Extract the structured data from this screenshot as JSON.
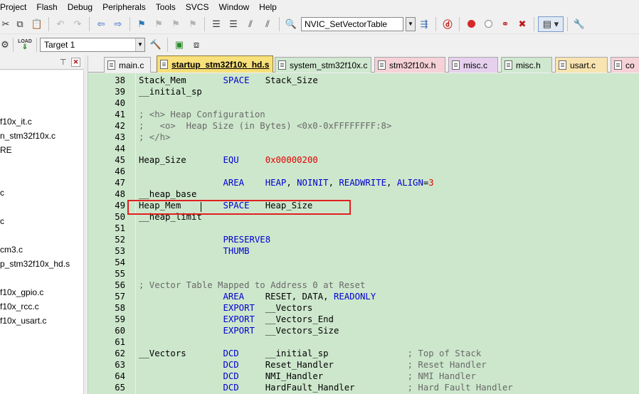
{
  "menu": [
    "Project",
    "Flash",
    "Debug",
    "Peripherals",
    "Tools",
    "SVCS",
    "Window",
    "Help"
  ],
  "toolbar": {
    "function_combo": "NVIC_SetVectorTable",
    "target_combo": "Target 1",
    "load_label": "LOAD"
  },
  "project_tree": [
    "f10x_it.c",
    "n_stm32f10x.c",
    "RE",
    "c",
    "c",
    "cm3.c",
    "p_stm32f10x_hd.s",
    "f10x_gpio.c",
    "f10x_rcc.c",
    "f10x_usart.c"
  ],
  "tabs": [
    {
      "label": "main.c",
      "color": "#f0f0f0",
      "active": false
    },
    {
      "label": "startup_stm32f10x_hd.s",
      "color": "#f8e07a",
      "active": true
    },
    {
      "label": "system_stm32f10x.c",
      "color": "#cfe8cf",
      "active": false
    },
    {
      "label": "stm32f10x.h",
      "color": "#f6d2d8",
      "active": false
    },
    {
      "label": "misc.c",
      "color": "#e6d0ee",
      "active": false
    },
    {
      "label": "misc.h",
      "color": "#cfe8cf",
      "active": false
    },
    {
      "label": "usart.c",
      "color": "#f8e4b0",
      "active": false
    },
    {
      "label": "co",
      "color": "#f6d2d8",
      "active": false
    }
  ],
  "code": [
    {
      "ln": "38",
      "parts": [
        [
          "Stack_Mem       ",
          ""
        ],
        [
          "SPACE",
          "k"
        ],
        [
          "   Stack_Size",
          ""
        ]
      ]
    },
    {
      "ln": "39",
      "parts": [
        [
          "__initial_sp",
          ""
        ]
      ]
    },
    {
      "ln": "40",
      "parts": []
    },
    {
      "ln": "41",
      "parts": [
        [
          "; <h> Heap Configuration",
          "c"
        ]
      ]
    },
    {
      "ln": "42",
      "parts": [
        [
          ";   <o>  Heap Size (in Bytes) <0x0-0xFFFFFFFF:8>",
          "c"
        ]
      ]
    },
    {
      "ln": "43",
      "parts": [
        [
          "; </h>",
          "c"
        ]
      ]
    },
    {
      "ln": "44",
      "parts": []
    },
    {
      "ln": "45",
      "parts": [
        [
          "Heap_Size       ",
          ""
        ],
        [
          "EQU",
          "k"
        ],
        [
          "     ",
          ""
        ],
        [
          "0x00000200",
          "n"
        ]
      ]
    },
    {
      "ln": "46",
      "parts": []
    },
    {
      "ln": "47",
      "parts": [
        [
          "                ",
          ""
        ],
        [
          "AREA",
          "k"
        ],
        [
          "    ",
          ""
        ],
        [
          "HEAP",
          "k"
        ],
        [
          ", ",
          ""
        ],
        [
          "NOINIT",
          "k"
        ],
        [
          ", ",
          ""
        ],
        [
          "READWRITE",
          "k"
        ],
        [
          ", ",
          ""
        ],
        [
          "ALIGN",
          "k"
        ],
        [
          "=",
          ""
        ],
        [
          "3",
          "n"
        ]
      ]
    },
    {
      "ln": "48",
      "parts": [
        [
          "__heap_base",
          ""
        ]
      ]
    },
    {
      "ln": "49",
      "parts": [
        [
          "Heap_Mem        ",
          ""
        ],
        [
          "SPACE",
          "k"
        ],
        [
          "   Heap_Size",
          ""
        ]
      ]
    },
    {
      "ln": "50",
      "parts": [
        [
          "__heap_limit",
          ""
        ]
      ]
    },
    {
      "ln": "51",
      "parts": []
    },
    {
      "ln": "52",
      "parts": [
        [
          "                ",
          ""
        ],
        [
          "PRESERVE8",
          "k"
        ]
      ]
    },
    {
      "ln": "53",
      "parts": [
        [
          "                ",
          ""
        ],
        [
          "THUMB",
          "k"
        ]
      ]
    },
    {
      "ln": "54",
      "parts": []
    },
    {
      "ln": "55",
      "parts": []
    },
    {
      "ln": "56",
      "parts": [
        [
          "; Vector Table Mapped to Address 0 at Reset",
          "c"
        ]
      ]
    },
    {
      "ln": "57",
      "parts": [
        [
          "                ",
          ""
        ],
        [
          "AREA",
          "k"
        ],
        [
          "    RESET, DATA, ",
          ""
        ],
        [
          "READONLY",
          "k"
        ]
      ]
    },
    {
      "ln": "58",
      "parts": [
        [
          "                ",
          ""
        ],
        [
          "EXPORT",
          "k"
        ],
        [
          "  __Vectors",
          ""
        ]
      ]
    },
    {
      "ln": "59",
      "parts": [
        [
          "                ",
          ""
        ],
        [
          "EXPORT",
          "k"
        ],
        [
          "  __Vectors_End",
          ""
        ]
      ]
    },
    {
      "ln": "60",
      "parts": [
        [
          "                ",
          ""
        ],
        [
          "EXPORT",
          "k"
        ],
        [
          "  __Vectors_Size",
          ""
        ]
      ]
    },
    {
      "ln": "61",
      "parts": []
    },
    {
      "ln": "62",
      "parts": [
        [
          "__Vectors       ",
          ""
        ],
        [
          "DCD",
          "k"
        ],
        [
          "     __initial_sp               ",
          ""
        ],
        [
          "; Top of Stack",
          "c"
        ]
      ]
    },
    {
      "ln": "63",
      "parts": [
        [
          "                ",
          ""
        ],
        [
          "DCD",
          "k"
        ],
        [
          "     Reset_Handler              ",
          ""
        ],
        [
          "; Reset Handler",
          "c"
        ]
      ]
    },
    {
      "ln": "64",
      "parts": [
        [
          "                ",
          ""
        ],
        [
          "DCD",
          "k"
        ],
        [
          "     NMI_Handler                ",
          ""
        ],
        [
          "; NMI Handler",
          "c"
        ]
      ]
    },
    {
      "ln": "65",
      "parts": [
        [
          "                ",
          ""
        ],
        [
          "DCD",
          "k"
        ],
        [
          "     HardFault_Handler          ",
          ""
        ],
        [
          "; Hard Fault Handler",
          "c"
        ]
      ]
    }
  ]
}
